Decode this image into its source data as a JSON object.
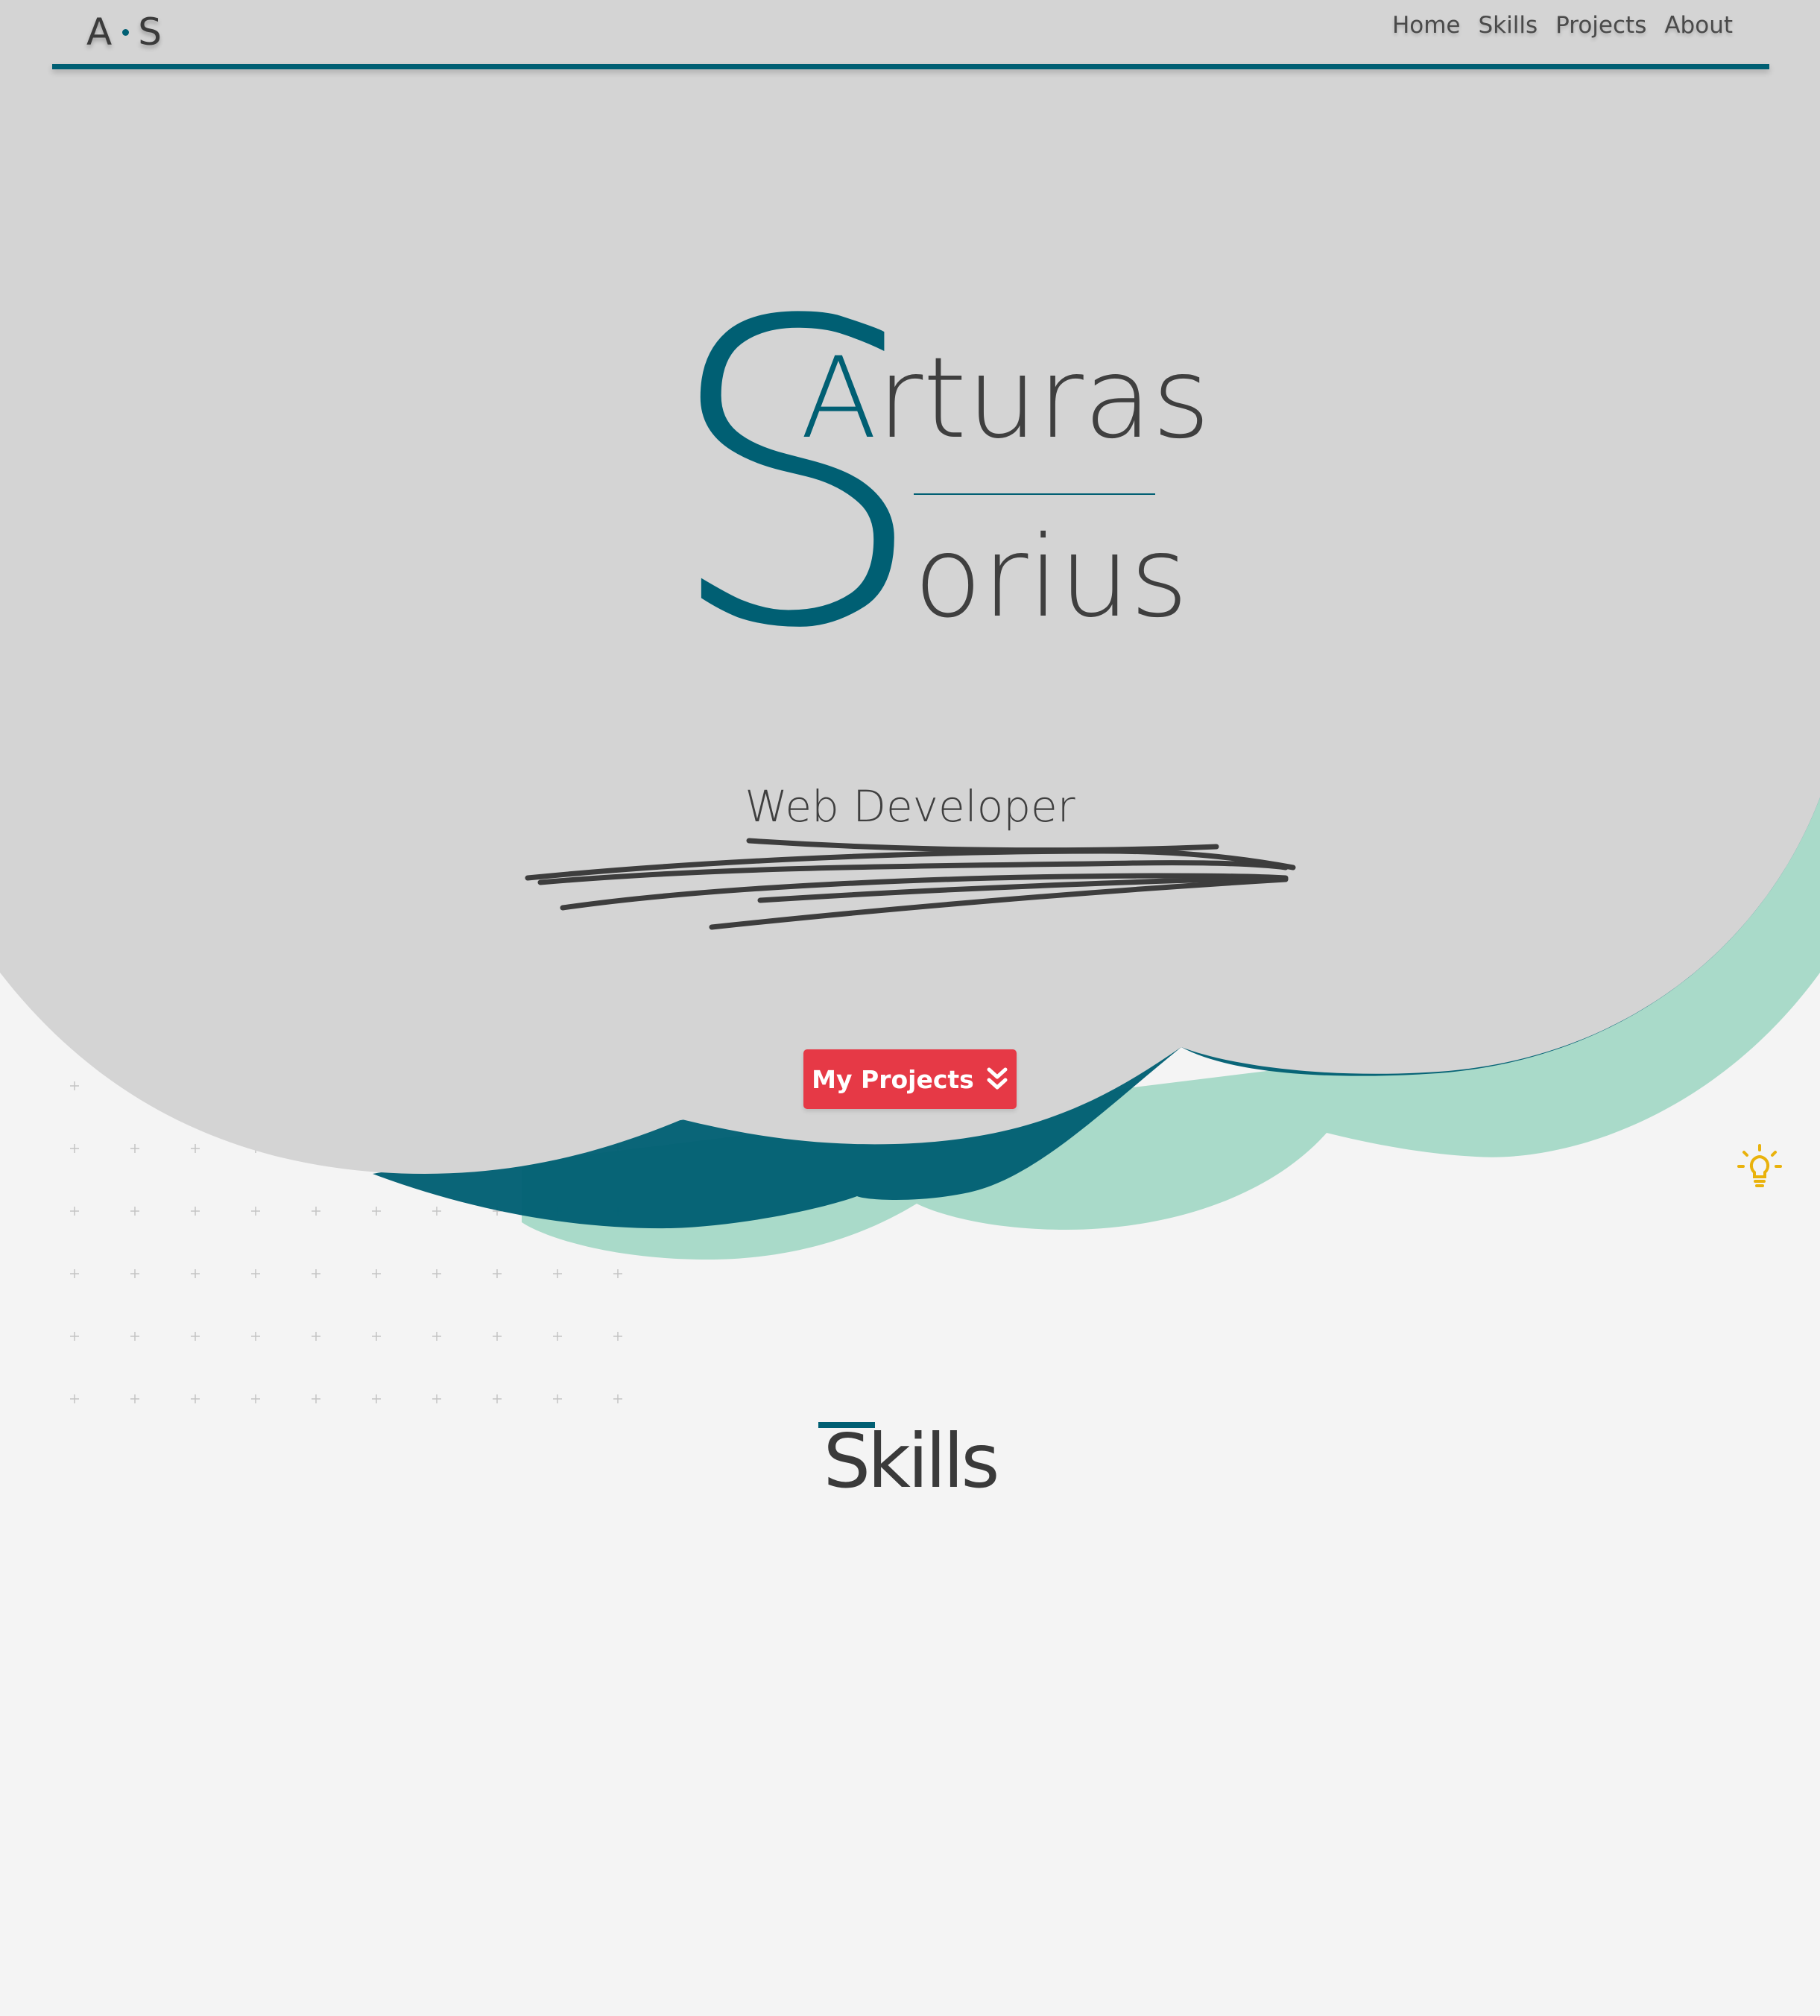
{
  "header": {
    "logo": {
      "left": "A",
      "right": "S"
    },
    "nav": [
      "Home",
      "Skills",
      "Projects",
      "About"
    ]
  },
  "hero": {
    "big_letter": "S",
    "first_initial": "A",
    "first_rest": "rturas",
    "last_rest": "orius",
    "subtitle": "Web Developer",
    "cta_label": "My Projects"
  },
  "section": {
    "title": "Skills"
  },
  "icons": [
    "chevron-double-down-icon",
    "lightbulb-icon"
  ],
  "colors": {
    "background": "#f4f4f4",
    "hero": "#d4d4d4",
    "primary": "#005f73",
    "wave_light": "#94d2bd",
    "accent": "#e63946",
    "bulb": "#e9b20c",
    "text": "#3f3f3f"
  }
}
